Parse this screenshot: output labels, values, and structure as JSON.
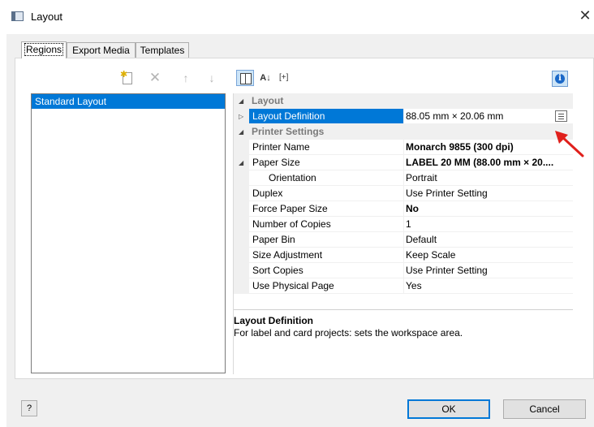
{
  "window": {
    "title": "Layout",
    "close_glyph": "✕"
  },
  "tabs": [
    {
      "label": "Regions",
      "selected": true
    },
    {
      "label": "Export Media",
      "selected": false
    },
    {
      "label": "Templates",
      "selected": false
    }
  ],
  "regions_toolbar": {
    "icons": [
      "new-region-icon",
      "delete-region-icon",
      "move-up-icon",
      "move-down-icon"
    ],
    "delete_glyph": "✕",
    "up_glyph": "↑",
    "down_glyph": "↓"
  },
  "regions": [
    {
      "label": "Standard Layout",
      "selected": true
    }
  ],
  "property_toolbar": {
    "alpha_glyph": "A↓",
    "expand_label": "[+]",
    "info_glyph": "i"
  },
  "property_grid": {
    "categories": {
      "layout": "Layout",
      "printer": "Printer Settings"
    },
    "layout_definition": {
      "name": "Layout Definition",
      "value": "88.05 mm × 20.06 mm"
    },
    "printer_rows": [
      {
        "name": "Printer Name",
        "value": "Monarch 9855 (300 dpi)",
        "bold": true
      },
      {
        "name": "Paper Size",
        "value": "LABEL 20 MM (88.00 mm × 20....",
        "bold": true
      },
      {
        "name": "Orientation",
        "value": "Portrait",
        "bold": false
      },
      {
        "name": "Duplex",
        "value": "Use Printer Setting",
        "bold": false
      },
      {
        "name": "Force Paper Size",
        "value": "No",
        "bold": true
      },
      {
        "name": "Number of Copies",
        "value": "1",
        "bold": false
      },
      {
        "name": "Paper Bin",
        "value": "Default",
        "bold": false
      },
      {
        "name": "Size Adjustment",
        "value": "Keep Scale",
        "bold": false
      },
      {
        "name": "Sort Copies",
        "value": "Use Printer Setting",
        "bold": false
      },
      {
        "name": "Use Physical Page",
        "value": "Yes",
        "bold": false
      }
    ]
  },
  "description": {
    "title": "Layout Definition",
    "text": "For label and card projects: sets the workspace area."
  },
  "buttons": {
    "ok": "OK",
    "cancel": "Cancel",
    "help_glyph": "?"
  },
  "colors": {
    "selection": "#0078d7",
    "annotation_arrow": "#e0201c"
  }
}
